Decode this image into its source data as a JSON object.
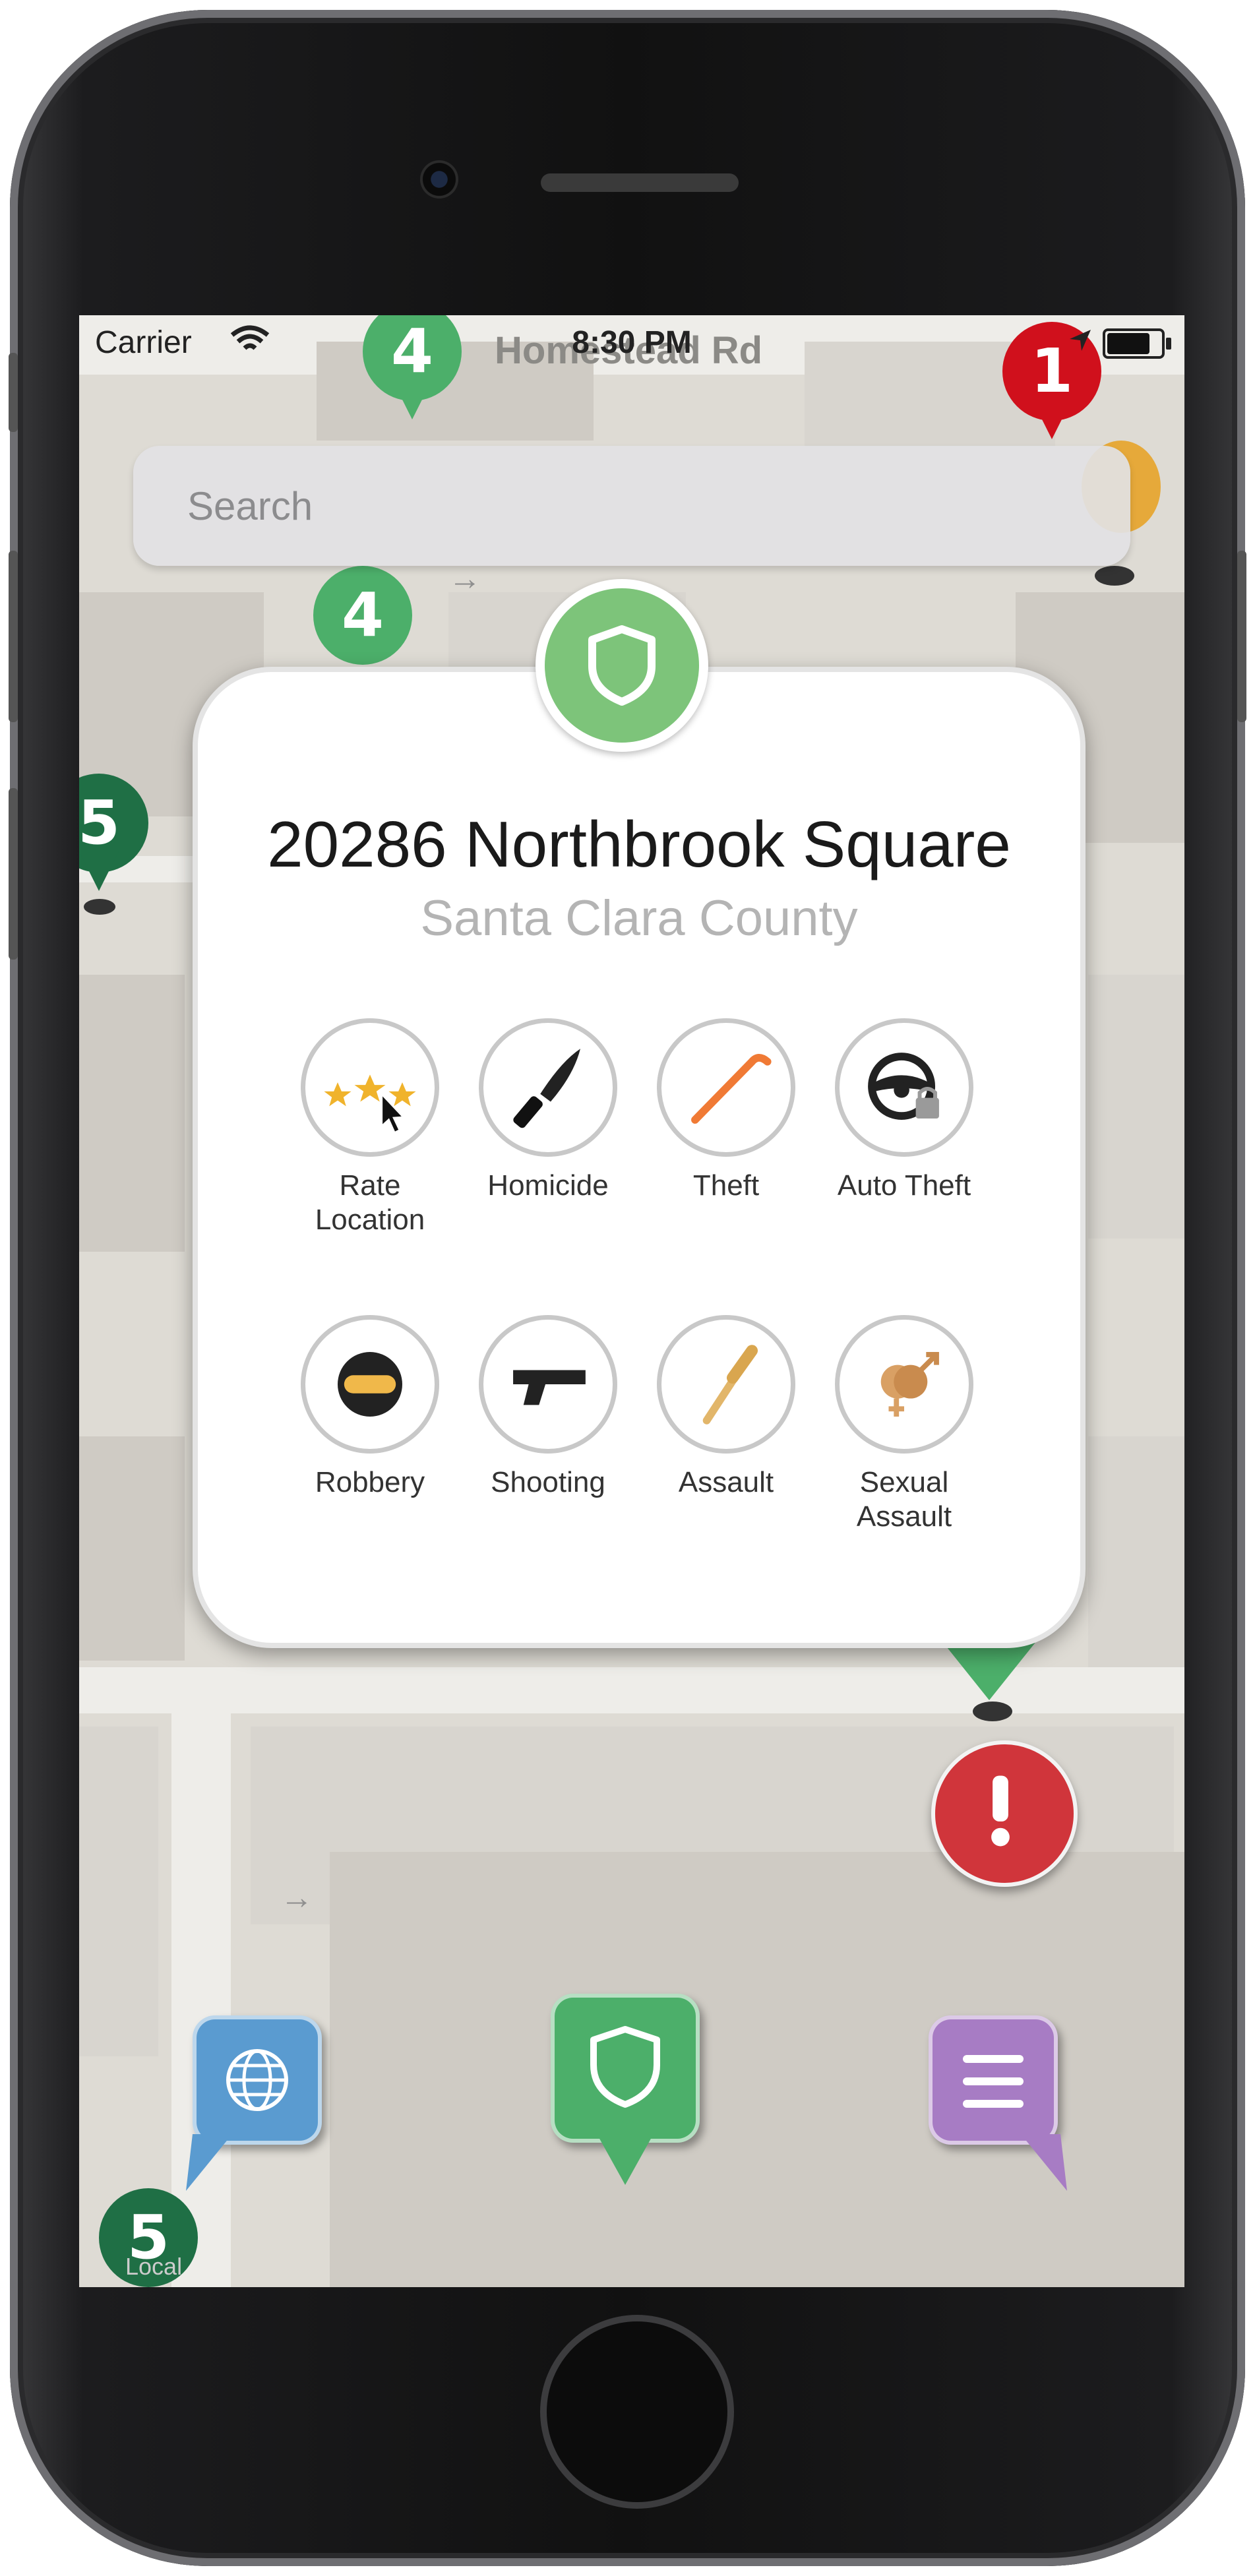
{
  "status_bar": {
    "carrier": "Carrier",
    "time": "8:30 PM",
    "wifi_icon": "wifi-icon",
    "location_icon": "location-arrow-icon",
    "battery_icon": "battery-icon"
  },
  "map": {
    "street_name": "Homestead Rd",
    "pins": [
      {
        "label": "4",
        "color": "#4caf6a"
      },
      {
        "label": "1",
        "color": "#d0101c"
      },
      {
        "label": "4",
        "color": "#4caf6a"
      },
      {
        "label": "5",
        "color": "#1f6f45"
      },
      {
        "label": "5",
        "color": "#1f6f45"
      }
    ],
    "local_label": "Local"
  },
  "search": {
    "placeholder": "Search"
  },
  "location_card": {
    "badge_icon": "shield-icon",
    "address": "20286 Northbrook Square",
    "county": "Santa Clara County",
    "actions": [
      {
        "label": "Rate\nLocation",
        "icon": "stars-icon"
      },
      {
        "label": "Homicide",
        "icon": "knife-icon"
      },
      {
        "label": "Theft",
        "icon": "crowbar-icon"
      },
      {
        "label": "Auto Theft",
        "icon": "steering-wheel-lock-icon"
      },
      {
        "label": "Robbery",
        "icon": "robber-mask-icon"
      },
      {
        "label": "Shooting",
        "icon": "pistol-icon"
      },
      {
        "label": "Assault",
        "icon": "baseball-bat-icon"
      },
      {
        "label": "Sexual\nAssault",
        "icon": "gender-symbols-icon"
      }
    ]
  },
  "bottom_bar": {
    "globe_icon": "globe-icon",
    "shield_icon": "shield-icon",
    "menu_icon": "menu-lines-icon",
    "globe_color": "#5a9bd0",
    "shield_color": "#4caf6a",
    "menu_color": "#a77cc4"
  },
  "alert_icon": "exclamation-icon",
  "alert_color": "#d0353b"
}
